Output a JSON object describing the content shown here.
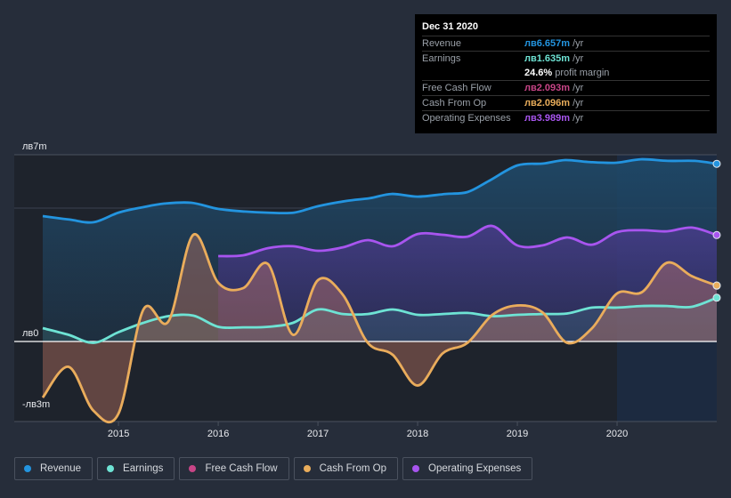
{
  "tooltip": {
    "date": "Dec 31 2020",
    "rows": [
      {
        "label": "Revenue",
        "value": "лв6.657m",
        "unit": " /yr",
        "color": "#2394df"
      },
      {
        "label": "Earnings",
        "value": "лв1.635m",
        "unit": " /yr",
        "color": "#6ee3d4"
      },
      {
        "label": "",
        "value": "24.6%",
        "unit": " profit margin",
        "color": "#ffffff"
      },
      {
        "label": "Free Cash Flow",
        "value": "лв2.093m",
        "unit": " /yr",
        "color": "#c84587"
      },
      {
        "label": "Cash From Op",
        "value": "лв2.096m",
        "unit": " /yr",
        "color": "#e9ad5b"
      },
      {
        "label": "Operating Expenses",
        "value": "лв3.989m",
        "unit": " /yr",
        "color": "#a855ef"
      }
    ]
  },
  "legend": [
    {
      "label": "Revenue",
      "color": "#2394df"
    },
    {
      "label": "Earnings",
      "color": "#6ee3d4"
    },
    {
      "label": "Free Cash Flow",
      "color": "#c84587"
    },
    {
      "label": "Cash From Op",
      "color": "#e9ad5b"
    },
    {
      "label": "Operating Expenses",
      "color": "#a855ef"
    }
  ],
  "chart_data": {
    "type": "area",
    "title": "",
    "xlabel": "",
    "ylabel": "",
    "currency": "лв",
    "ylim": [
      -3,
      7
    ],
    "xlim": [
      2014.24,
      2021.0
    ],
    "y_ticks": [
      {
        "value": 7,
        "label": "лв7m"
      },
      {
        "value": 0,
        "label": "лв0"
      },
      {
        "value": -2.67,
        "label": "-лв3m"
      }
    ],
    "x_ticks": [
      {
        "value": 2015,
        "label": "2015"
      },
      {
        "value": 2016,
        "label": "2016"
      },
      {
        "value": 2017,
        "label": "2017"
      },
      {
        "value": 2018,
        "label": "2018"
      },
      {
        "value": 2019,
        "label": "2019"
      },
      {
        "value": 2020,
        "label": "2020"
      }
    ],
    "grid": true,
    "highlight_from": 2020.0,
    "series": [
      {
        "name": "Revenue",
        "color": "#2394df",
        "x": [
          2014.24,
          2014.51,
          2014.75,
          2015.0,
          2015.24,
          2015.46,
          2015.73,
          2016.0,
          2016.27,
          2016.49,
          2016.76,
          2017.0,
          2017.29,
          2017.52,
          2017.74,
          2018.0,
          2018.28,
          2018.5,
          2018.72,
          2019.0,
          2019.26,
          2019.48,
          2019.71,
          2019.99,
          2020.24,
          2020.51,
          2020.78,
          2021.0
        ],
        "y": [
          4.7,
          4.57,
          4.47,
          4.83,
          5.03,
          5.17,
          5.2,
          4.97,
          4.87,
          4.83,
          4.83,
          5.07,
          5.27,
          5.37,
          5.53,
          5.43,
          5.53,
          5.6,
          6.03,
          6.6,
          6.67,
          6.8,
          6.73,
          6.7,
          6.83,
          6.77,
          6.77,
          6.66
        ]
      },
      {
        "name": "Earnings",
        "color": "#6ee3d4",
        "x": [
          2014.24,
          2014.5,
          2014.75,
          2015.0,
          2015.25,
          2015.5,
          2015.75,
          2016.0,
          2016.25,
          2016.5,
          2016.75,
          2017.0,
          2017.25,
          2017.5,
          2017.75,
          2018.0,
          2018.25,
          2018.5,
          2018.75,
          2019.0,
          2019.25,
          2019.5,
          2019.75,
          2020.0,
          2020.25,
          2020.5,
          2020.75,
          2021.0
        ],
        "y": [
          0.5,
          0.25,
          -0.05,
          0.35,
          0.7,
          0.95,
          0.97,
          0.55,
          0.53,
          0.55,
          0.7,
          1.2,
          1.03,
          1.03,
          1.2,
          1.0,
          1.03,
          1.07,
          0.95,
          1.0,
          1.03,
          1.05,
          1.27,
          1.27,
          1.33,
          1.33,
          1.3,
          1.64
        ]
      },
      {
        "name": "Free Cash Flow",
        "color": "#c84587",
        "x": [
          2014.24,
          2014.5,
          2014.75,
          2015.0,
          2015.25,
          2015.5,
          2015.75,
          2016.0,
          2016.25,
          2016.5,
          2016.75,
          2017.0,
          2017.25,
          2017.5,
          2017.75,
          2018.0,
          2018.25,
          2018.5,
          2018.75,
          2019.0,
          2019.25,
          2019.5,
          2019.75,
          2020.0,
          2020.25,
          2020.5,
          2020.75,
          2021.0
        ],
        "y": [
          -2.1,
          -0.95,
          -2.6,
          -2.7,
          1.2,
          0.75,
          4.0,
          2.2,
          2.0,
          2.9,
          0.25,
          2.3,
          1.75,
          -0.05,
          -0.5,
          -1.65,
          -0.45,
          -0.05,
          1.0,
          1.35,
          1.1,
          -0.05,
          0.5,
          1.8,
          1.85,
          2.95,
          2.45,
          2.09
        ]
      },
      {
        "name": "Cash From Op",
        "color": "#e9ad5b",
        "x": [
          2014.24,
          2014.5,
          2014.75,
          2015.0,
          2015.25,
          2015.5,
          2015.75,
          2016.0,
          2016.25,
          2016.5,
          2016.75,
          2017.0,
          2017.25,
          2017.5,
          2017.75,
          2018.0,
          2018.25,
          2018.5,
          2018.75,
          2019.0,
          2019.25,
          2019.5,
          2019.75,
          2020.0,
          2020.25,
          2020.5,
          2020.75,
          2021.0
        ],
        "y": [
          -2.1,
          -0.95,
          -2.6,
          -2.7,
          1.2,
          0.75,
          4.0,
          2.2,
          2.0,
          2.9,
          0.25,
          2.3,
          1.75,
          -0.05,
          -0.5,
          -1.65,
          -0.45,
          -0.05,
          1.0,
          1.35,
          1.1,
          -0.05,
          0.5,
          1.8,
          1.85,
          2.95,
          2.45,
          2.1
        ]
      },
      {
        "name": "Operating Expenses",
        "color": "#a855ef",
        "x": [
          2016.0,
          2016.25,
          2016.5,
          2016.75,
          2017.0,
          2017.25,
          2017.5,
          2017.75,
          2018.0,
          2018.25,
          2018.5,
          2018.75,
          2019.0,
          2019.25,
          2019.5,
          2019.75,
          2020.0,
          2020.25,
          2020.5,
          2020.75,
          2021.0
        ],
        "y": [
          3.2,
          3.23,
          3.5,
          3.57,
          3.4,
          3.53,
          3.8,
          3.57,
          4.03,
          4.0,
          3.93,
          4.33,
          3.6,
          3.6,
          3.9,
          3.63,
          4.1,
          4.17,
          4.13,
          4.27,
          3.99
        ]
      }
    ]
  }
}
